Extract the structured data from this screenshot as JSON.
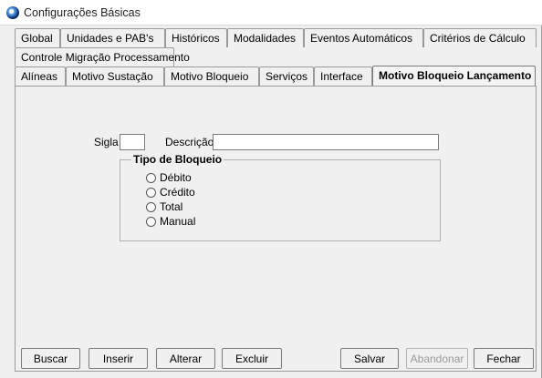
{
  "window": {
    "title": "Configurações Básicas"
  },
  "tabs_row1": [
    {
      "label": "Global"
    },
    {
      "label": "Unidades e PAB's"
    },
    {
      "label": "Históricos"
    },
    {
      "label": "Modalidades"
    },
    {
      "label": "Eventos Automáticos"
    },
    {
      "label": "Critérios de Cálculo"
    }
  ],
  "tabs_row2": [
    {
      "label": "Controle Migração Processamento"
    }
  ],
  "tabs_row3": [
    {
      "label": "Alíneas"
    },
    {
      "label": "Motivo Sustação"
    },
    {
      "label": "Motivo Bloqueio"
    },
    {
      "label": "Serviços"
    },
    {
      "label": "Interface"
    },
    {
      "label": "Motivo Bloqueio Lançamento",
      "active": true
    }
  ],
  "form": {
    "sigla_label": "Sigla",
    "sigla_value": "",
    "descricao_label": "Descrição",
    "descricao_value": "",
    "tipo_title": "Tipo de Bloqueio",
    "tipo_options": [
      "Débito",
      "Crédito",
      "Total",
      "Manual"
    ]
  },
  "buttons": {
    "buscar": "Buscar",
    "inserir": "Inserir",
    "alterar": "Alterar",
    "excluir": "Excluir",
    "salvar": "Salvar",
    "abandonar": "Abandonar",
    "fechar": "Fechar"
  }
}
